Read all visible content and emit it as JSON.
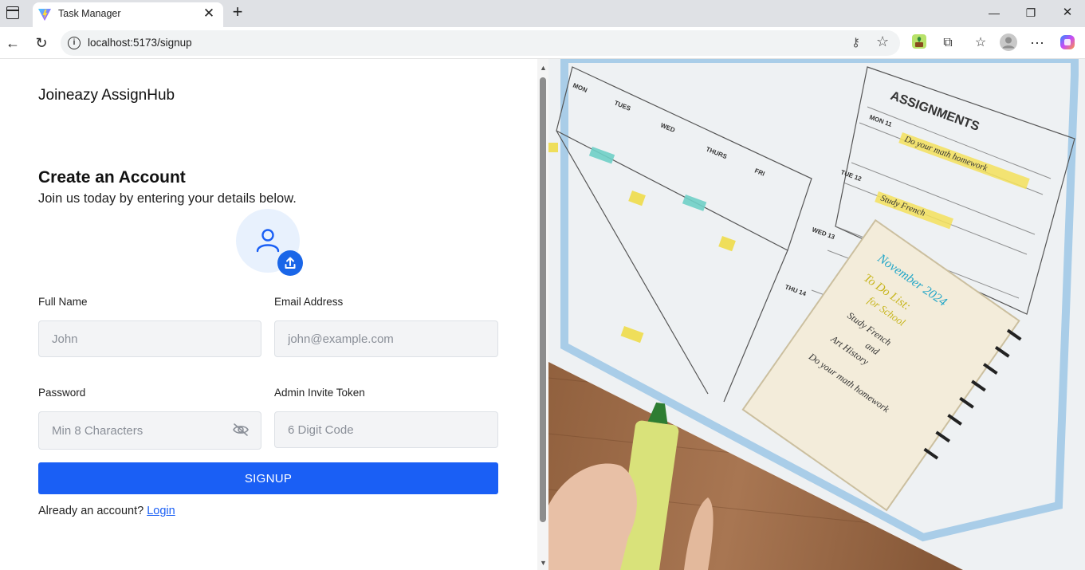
{
  "browser": {
    "tab_title": "Task Manager",
    "url": "localhost:5173/signup"
  },
  "page": {
    "brand": "Joineazy AssignHub",
    "title": "Create an Account",
    "subtitle": "Join us today by entering your details below.",
    "fields": {
      "full_name": {
        "label": "Full Name",
        "placeholder": "John",
        "value": ""
      },
      "email": {
        "label": "Email Address",
        "placeholder": "john@example.com",
        "value": ""
      },
      "password": {
        "label": "Password",
        "placeholder": "Min 8 Characters",
        "value": ""
      },
      "admin_token": {
        "label": "Admin Invite Token",
        "placeholder": "6 Digit Code",
        "value": ""
      }
    },
    "signup_label": "SIGNUP",
    "login_prompt": "Already an account?",
    "login_link": "Login"
  },
  "image": {
    "planner_heading": "ASSIGNMENTS",
    "planner_days": [
      "MON",
      "TUES",
      "WED",
      "THURS",
      "FRI"
    ],
    "assignment_rows": [
      {
        "day": "MON 11",
        "task": "Do your math homework"
      },
      {
        "day": "TUE 12",
        "task": "Study French"
      },
      {
        "day": "WED 13",
        "task": ""
      },
      {
        "day": "THU 14",
        "task": ""
      }
    ],
    "notepad_lines": [
      "November 2024",
      "To Do List:",
      "for School",
      "Study French",
      "and",
      "Art History",
      "Do your math homework"
    ]
  },
  "colors": {
    "primary": "#1a5ff5",
    "avatar_bg": "#e8f1fd",
    "input_bg": "#f3f4f6"
  },
  "icons": {
    "avatar": "user-icon",
    "upload": "upload-icon",
    "password_toggle": "eye-off-icon"
  }
}
